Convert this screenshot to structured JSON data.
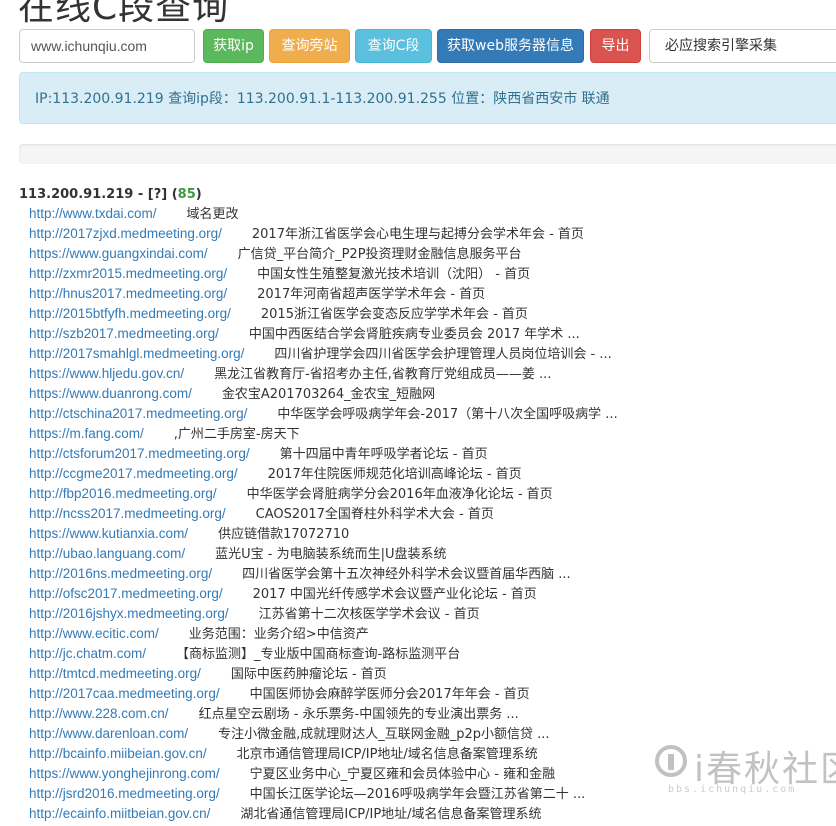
{
  "page": {
    "title": "在线C段查询"
  },
  "toolbar": {
    "domain_value": "www.ichunqiu.com",
    "get_ip_label": "获取ip",
    "query_side_label": "查询旁站",
    "query_c_label": "查询C段",
    "web_server_label": "获取web服务器信息",
    "logout_label": "导出",
    "engine_selected": "必应搜索引擎采集"
  },
  "ip_info": {
    "text": "IP:113.200.91.219 查询ip段：113.200.91.1-113.200.91.255 位置：陕西省西安市 联通"
  },
  "result_group": {
    "ip_prefix": "113.200.91.219 - [?] (",
    "count": "85",
    "suffix": ")"
  },
  "results": [
    {
      "url": "http://www.txdai.com/",
      "title": "域名更改"
    },
    {
      "url": "http://2017zjxd.medmeeting.org/",
      "title": "2017年浙江省医学会心电生理与起搏分会学术年会 - 首页"
    },
    {
      "url": "https://www.guangxindai.com/",
      "title": "广信贷_平台简介_P2P投资理财金融信息服务平台"
    },
    {
      "url": "http://zxmr2015.medmeeting.org/",
      "title": "中国女性生殖整复激光技术培训（沈阳） - 首页"
    },
    {
      "url": "http://hnus2017.medmeeting.org/",
      "title": "2017年河南省超声医学学术年会 - 首页"
    },
    {
      "url": "http://2015btfyfh.medmeeting.org/",
      "title": "2015浙江省医学会变态反应学学术年会 - 首页"
    },
    {
      "url": "http://szb2017.medmeeting.org/",
      "title": "中国中西医结合学会肾脏疾病专业委员会 2017 年学术 ..."
    },
    {
      "url": "http://2017smahlgl.medmeeting.org/",
      "title": "四川省护理学会四川省医学会护理管理人员岗位培训会 - ..."
    },
    {
      "url": "https://www.hljedu.gov.cn/",
      "title": "黑龙江省教育厅-省招考办主任,省教育厅党组成员——姜 ..."
    },
    {
      "url": "https://www.duanrong.com/",
      "title": "金农宝A201703264_金农宝_短融网"
    },
    {
      "url": "http://ctschina2017.medmeeting.org/",
      "title": "中华医学会呼吸病学年会-2017（第十八次全国呼吸病学 ..."
    },
    {
      "url": "https://m.fang.com/",
      "title": ",广州二手房室-房天下"
    },
    {
      "url": "http://ctsforum2017.medmeeting.org/",
      "title": "第十四届中青年呼吸学者论坛 - 首页"
    },
    {
      "url": "http://ccgme2017.medmeeting.org/",
      "title": "2017年住院医师规范化培训高峰论坛 - 首页"
    },
    {
      "url": "http://fbp2016.medmeeting.org/",
      "title": "中华医学会肾脏病学分会2016年血液净化论坛 - 首页"
    },
    {
      "url": "http://ncss2017.medmeeting.org/",
      "title": "CAOS2017全国脊柱外科学术大会 - 首页"
    },
    {
      "url": "https://www.kutianxia.com/",
      "title": "供应链借款17072710"
    },
    {
      "url": "http://ubao.languang.com/",
      "title": "蓝光U宝 - 为电脑装系统而生|U盘装系统"
    },
    {
      "url": "http://2016ns.medmeeting.org/",
      "title": "四川省医学会第十五次神经外科学术会议暨首届华西脑 ..."
    },
    {
      "url": "http://ofsc2017.medmeeting.org/",
      "title": "2017 中国光纤传感学术会议暨产业化论坛 - 首页"
    },
    {
      "url": "http://2016jshyx.medmeeting.org/",
      "title": "江苏省第十二次核医学学术会议 - 首页"
    },
    {
      "url": "http://www.ecitic.com/",
      "title": "业务范围：业务介绍>中信资产"
    },
    {
      "url": "http://jc.chatm.com/",
      "title": "【商标监测】_专业版中国商标查询-路标监测平台"
    },
    {
      "url": "http://tmtcd.medmeeting.org/",
      "title": "国际中医药肿瘤论坛 - 首页"
    },
    {
      "url": "http://2017caa.medmeeting.org/",
      "title": "中国医师协会麻醉学医师分会2017年年会 - 首页"
    },
    {
      "url": "http://www.228.com.cn/",
      "title": "红点星空云剧场 - 永乐票务-中国领先的专业演出票务 ..."
    },
    {
      "url": "http://www.darenloan.com/",
      "title": "专注小微金融,成就理财达人_互联网金融_p2p小额信贷 ..."
    },
    {
      "url": "http://bcainfo.miibeian.gov.cn/",
      "title": "北京市通信管理局ICP/IP地址/域名信息备案管理系统"
    },
    {
      "url": "https://www.yonghejinrong.com/",
      "title": "宁夏区业务中心_宁夏区雍和会员体验中心 - 雍和金融"
    },
    {
      "url": "http://jsrd2016.medmeeting.org/",
      "title": "中国长江医学论坛—2016呼吸病学年会暨江苏省第二十 ..."
    },
    {
      "url": "http://ecainfo.miitbeian.gov.cn/",
      "title": "湖北省通信管理局ICP/IP地址/域名信息备案管理系统"
    }
  ],
  "watermark": {
    "text": "i春秋社区",
    "sub": "bbs.ichunqiu.com"
  }
}
